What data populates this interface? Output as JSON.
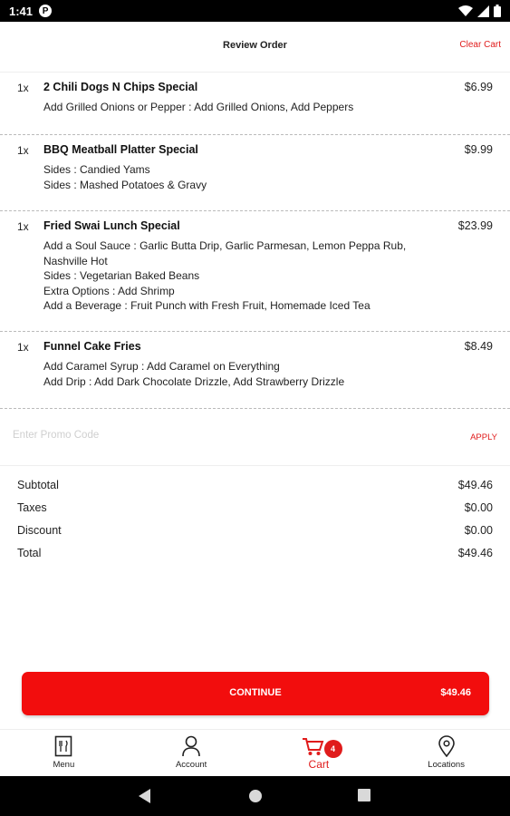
{
  "status_bar": {
    "time": "1:41",
    "notification_badge": "P"
  },
  "header": {
    "title": "Review Order",
    "clear_cart": "Clear Cart"
  },
  "items": [
    {
      "qty": "1x",
      "name": "2 Chili Dogs N Chips Special",
      "price": "$6.99",
      "mods": [
        "Add Grilled Onions or Pepper : Add Grilled Onions, Add Peppers"
      ]
    },
    {
      "qty": "1x",
      "name": "BBQ Meatball Platter Special",
      "price": "$9.99",
      "mods": [
        "Sides : Candied Yams",
        "Sides : Mashed Potatoes & Gravy"
      ]
    },
    {
      "qty": "1x",
      "name": "Fried Swai Lunch Special",
      "price": "$23.99",
      "mods": [
        "Add a Soul Sauce : Garlic Butta Drip, Garlic Parmesan, Lemon Peppa Rub, Nashville Hot",
        "Sides : Vegetarian Baked Beans",
        "Extra Options : Add Shrimp",
        "Add a Beverage : Fruit Punch with Fresh Fruit, Homemade Iced Tea"
      ]
    },
    {
      "qty": "1x",
      "name": "Funnel Cake Fries",
      "price": "$8.49",
      "mods": [
        "Add Caramel Syrup  : Add Caramel on Everything",
        "Add Drip : Add Dark Chocolate Drizzle, Add Strawberry Drizzle"
      ]
    }
  ],
  "promo": {
    "placeholder": "Enter Promo Code",
    "value": "",
    "apply": "APPLY"
  },
  "totals": [
    {
      "label": "Subtotal",
      "value": "$49.46"
    },
    {
      "label": "Taxes",
      "value": "$0.00"
    },
    {
      "label": "Discount",
      "value": "$0.00"
    },
    {
      "label": "Total",
      "value": "$49.46"
    }
  ],
  "continue_button": {
    "label": "CONTINUE",
    "price": "$49.46"
  },
  "bottom_nav": {
    "items": [
      {
        "label": "Menu",
        "icon": "menu-book-icon"
      },
      {
        "label": "Account",
        "icon": "person-icon"
      },
      {
        "label": "Cart",
        "icon": "cart-icon",
        "badge": "4",
        "active": true
      },
      {
        "label": "Locations",
        "icon": "location-pin-icon"
      }
    ]
  },
  "colors": {
    "accent": "#e01b1b",
    "button": "#f20d0d"
  }
}
